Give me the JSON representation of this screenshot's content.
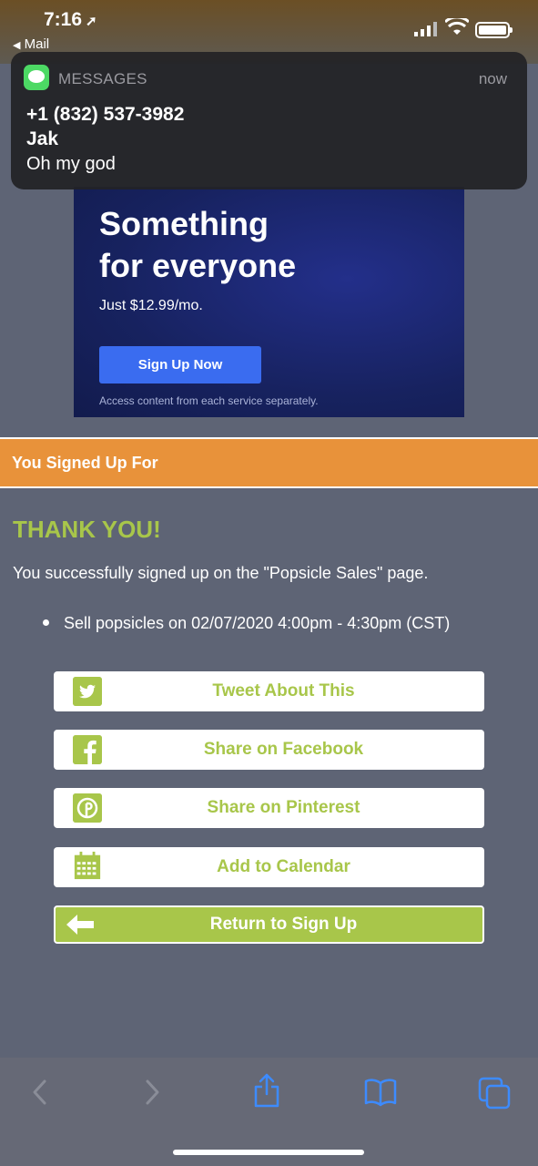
{
  "status_bar": {
    "time": "7:16",
    "back_label": "Mail"
  },
  "notification": {
    "app_name": "MESSAGES",
    "time": "now",
    "phone": "+1 (832) 537-3982",
    "sender": "Jak",
    "body": "Oh my god"
  },
  "ad": {
    "headline_line1": "Something",
    "headline_line2": "for everyone",
    "price": "Just $12.99/mo.",
    "button": "Sign Up Now",
    "footnote": "Access content from each service separately."
  },
  "section_header": "You Signed Up For",
  "thank_you": "THANK YOU!",
  "success_text": "You successfully signed up on the \"Popsicle Sales\" page.",
  "slots": [
    "Sell popsicles on 02/07/2020 4:00pm - 4:30pm (CST)"
  ],
  "buttons": {
    "tweet": "Tweet About This",
    "facebook": "Share on Facebook",
    "pinterest": "Share on Pinterest",
    "calendar": "Add to Calendar",
    "return": "Return to Sign Up"
  },
  "colors": {
    "accent_green": "#a8c64a",
    "header_orange": "#e8923a",
    "page_bg": "#5e6475",
    "ios_blue": "#3d8bff"
  },
  "toolbar_icons": [
    "back-icon",
    "forward-icon",
    "share-icon",
    "bookmarks-icon",
    "tabs-icon"
  ]
}
